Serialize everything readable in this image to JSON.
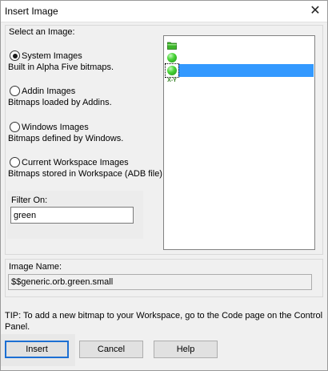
{
  "window": {
    "title": "Insert Image",
    "close_glyph": "✕"
  },
  "select_group": {
    "label": "Select an Image:",
    "options": [
      {
        "label": "System Images",
        "description": "Built in Alpha Five bitmaps.",
        "checked": true
      },
      {
        "label": "Addin Images",
        "description": "Bitmaps loaded by Addins.",
        "checked": false
      },
      {
        "label": "Windows Images",
        "description": "Bitmaps defined by Windows.",
        "checked": false
      },
      {
        "label": "Current Workspace Images",
        "description": "Bitmaps stored in Workspace (ADB file).",
        "checked": false
      }
    ]
  },
  "filter": {
    "label": "Filter On:",
    "value": "green"
  },
  "image_list": {
    "items": [
      {
        "icon": "green-folder-icon",
        "selected": false
      },
      {
        "icon": "green-orb-icon",
        "selected": false
      },
      {
        "icon": "green-orb-small-icon",
        "selected": true
      },
      {
        "icon": "xy-text-icon",
        "icon_text": "X-Y",
        "selected": false
      }
    ]
  },
  "image_name": {
    "label": "Image Name:",
    "value": "$$generic.orb.green.small"
  },
  "tip": "TIP: To add a new bitmap to your Workspace, go to the Code page on the Control Panel.",
  "buttons": {
    "insert": "Insert",
    "cancel": "Cancel",
    "help": "Help"
  },
  "colors": {
    "selection": "#3399ff",
    "default_button_border": "#1c6fd3",
    "orb_green": "#4bd63a"
  }
}
